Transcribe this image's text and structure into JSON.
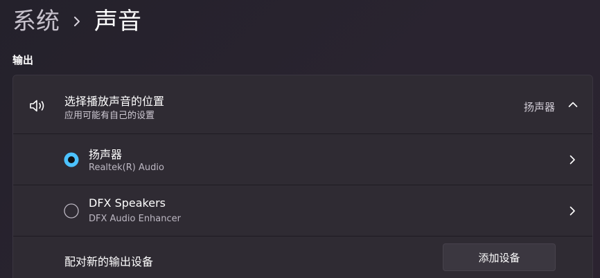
{
  "breadcrumb": {
    "parent": "系统",
    "current": "声音"
  },
  "section": {
    "title": "输出"
  },
  "output_selector": {
    "title": "选择播放声音的位置",
    "subtitle": "应用可能有自己的设置",
    "selected_value": "扬声器",
    "icon": "speaker-icon",
    "expanded": true
  },
  "devices": [
    {
      "name": "扬声器",
      "description": "Realtek(R) Audio",
      "selected": true
    },
    {
      "name": "DFX Speakers",
      "description": "DFX Audio Enhancer",
      "selected": false
    }
  ],
  "pair_row": {
    "label": "配对新的输出设备",
    "button_label": "添加设备"
  },
  "colors": {
    "accent": "#4cc2ff",
    "card_bg": "#2f2b33",
    "page_bg": "#272329"
  }
}
